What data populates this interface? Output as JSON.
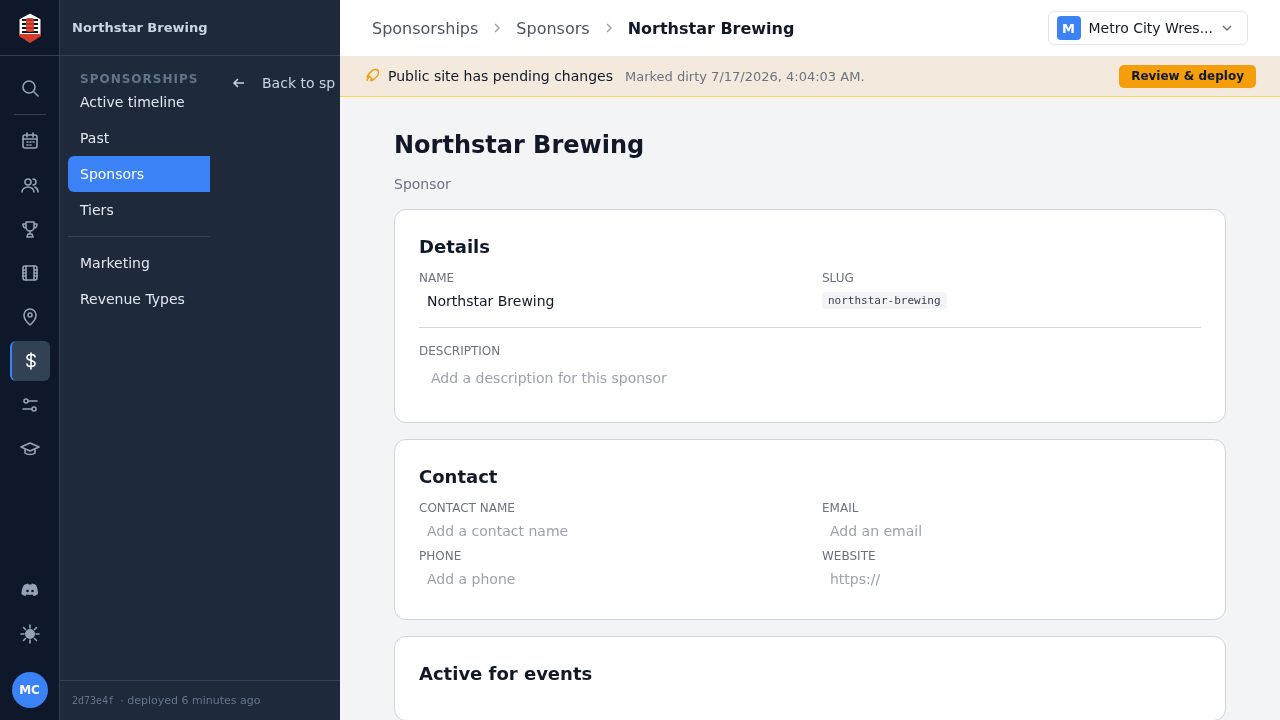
{
  "rail": {
    "items": [
      {
        "selected": false
      },
      {
        "selected": false
      },
      {
        "selected": false
      },
      {
        "selected": false
      },
      {
        "selected": false
      },
      {
        "selected": false
      },
      {
        "selected": true
      },
      {
        "selected": false
      },
      {
        "selected": false
      }
    ],
    "avatar": "MC"
  },
  "panel": {
    "title": "Northstar Brewing",
    "section": "SPONSORSHIPS",
    "items": [
      {
        "label": "Active timeline",
        "selected": false
      },
      {
        "label": "Past",
        "selected": false
      },
      {
        "label": "Sponsors",
        "selected": true
      },
      {
        "label": "Tiers",
        "selected": false
      }
    ],
    "more_items": [
      {
        "label": "Marketing",
        "selected": false
      },
      {
        "label": "Revenue Types",
        "selected": false
      }
    ],
    "back": "Back to sp",
    "footer": {
      "hash": "2d73e4f",
      "text": "· deployed 6 minutes ago"
    }
  },
  "breadcrumbs": [
    "Sponsorships",
    "Sponsors",
    "Northstar Brewing"
  ],
  "org": {
    "initial": "M",
    "name": "Metro City Wres..."
  },
  "banner": {
    "title": "Public site has pending changes",
    "detail": "Marked dirty 7/17/2026, 4:04:03 AM.",
    "button": "Review & deploy"
  },
  "page": {
    "title": "Northstar Brewing",
    "subtitle": "Sponsor"
  },
  "cards": [
    {
      "title": "Details",
      "rows": [
        [
          {
            "label": "NAME",
            "kind": "input",
            "value": "Northstar Brewing"
          },
          {
            "label": "SLUG",
            "kind": "code",
            "value": "northstar-brewing"
          }
        ],
        [
          {
            "label": "DESCRIPTION",
            "kind": "input",
            "placeholder": "Add a description for this sponsor"
          }
        ]
      ],
      "divided": true
    },
    {
      "title": "Contact",
      "rows": [
        [
          {
            "label": "CONTACT NAME",
            "kind": "input",
            "placeholder": "Add a contact name"
          },
          {
            "label": "EMAIL",
            "kind": "input",
            "placeholder": "Add an email"
          }
        ],
        [
          {
            "label": "PHONE",
            "kind": "input",
            "placeholder": "Add a phone"
          },
          {
            "label": "WEBSITE",
            "kind": "input",
            "placeholder": "https://"
          }
        ]
      ],
      "divided": false
    },
    {
      "title": "Active for events"
    }
  ]
}
